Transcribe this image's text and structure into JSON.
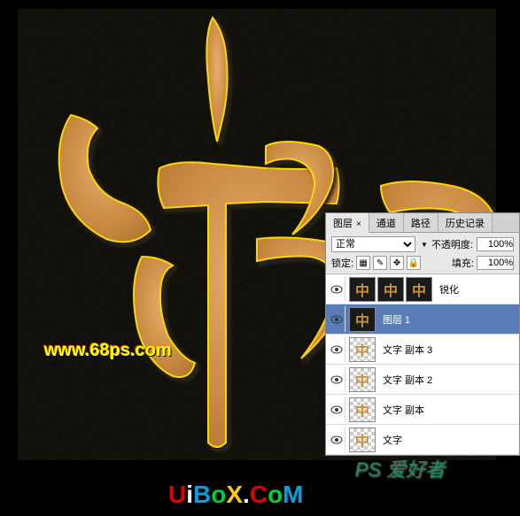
{
  "watermarks": {
    "ps68": "www.68ps.com",
    "ps_text": "PS 爱好者",
    "uibox": "UiBoX.CoM"
  },
  "panel": {
    "tabs": {
      "layers": "图层",
      "channels": "通道",
      "paths": "路径",
      "history": "历史记录"
    },
    "blend_mode": "正常",
    "opacity_label": "不透明度:",
    "opacity_value": "100%",
    "lock_label": "锁定:",
    "fill_label": "填充:",
    "fill_value": "100%",
    "layers": [
      {
        "name": "锐化",
        "selected": false,
        "multi_thumb": true
      },
      {
        "name": "图层 1",
        "selected": true,
        "multi_thumb": false
      },
      {
        "name": "文字 副本 3",
        "selected": false,
        "multi_thumb": false
      },
      {
        "name": "文字 副本 2",
        "selected": false,
        "multi_thumb": false
      },
      {
        "name": "文字 副本",
        "selected": false,
        "multi_thumb": false
      },
      {
        "name": "文字",
        "selected": false,
        "multi_thumb": false
      }
    ]
  }
}
